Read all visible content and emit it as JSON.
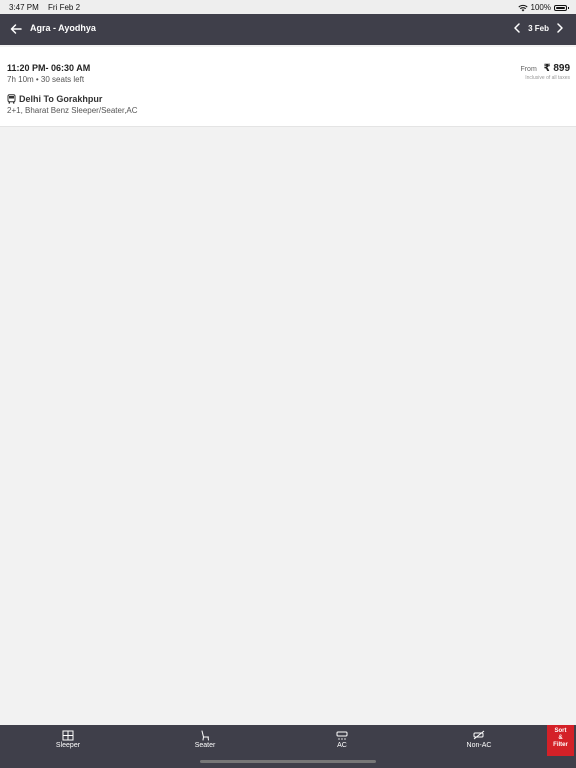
{
  "status_bar": {
    "time": "3:47 PM",
    "date": "Fri Feb 2",
    "battery": "100%"
  },
  "header": {
    "route_title": "Agra - Ayodhya",
    "date": "3 Feb"
  },
  "bus": {
    "times": "11:20 PM- 06:30 AM",
    "duration_seats": "7h 10m • 30 seats left",
    "from_label": "From",
    "price": "₹ 899",
    "taxes_note": "Inclusive of all taxes",
    "operator": "Delhi To Gorakhpur",
    "bus_type": "2+1, Bharat Benz Sleeper/Seater,AC"
  },
  "filters": [
    {
      "label": "Sleeper",
      "icon": "sleeper-icon"
    },
    {
      "label": "Seater",
      "icon": "seater-icon"
    },
    {
      "label": "AC",
      "icon": "ac-icon"
    },
    {
      "label": "Non-AC",
      "icon": "non-ac-icon"
    }
  ],
  "sort_filter": {
    "line1": "Sort",
    "line2": "&",
    "line3": "Filter"
  },
  "colors": {
    "header_bg": "#3f3f4a",
    "accent_red": "#d42128",
    "page_bg": "#f2f2f2"
  }
}
